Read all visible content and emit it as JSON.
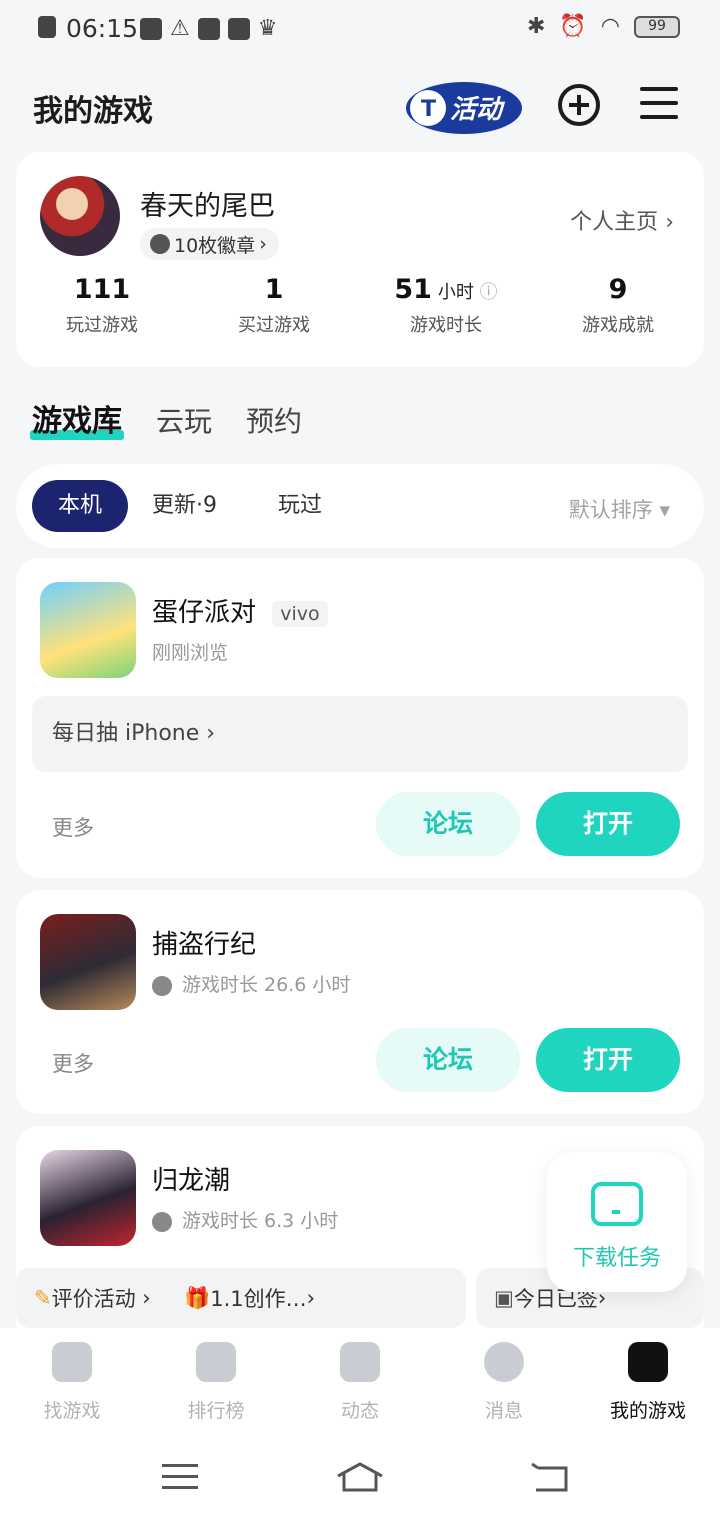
{
  "status_bar": {
    "time": "06:15",
    "battery": "99"
  },
  "header": {
    "title": "我的游戏",
    "activity_logo_text": "活动"
  },
  "profile": {
    "username": "春天的尾巴",
    "badges": "10枚徽章",
    "home_link": "个人主页",
    "stats": [
      {
        "value": "111",
        "unit": "",
        "label": "玩过游戏"
      },
      {
        "value": "1",
        "unit": "",
        "label": "买过游戏"
      },
      {
        "value": "51",
        "unit": "小时",
        "label": "游戏时长"
      },
      {
        "value": "9",
        "unit": "",
        "label": "游戏成就"
      }
    ]
  },
  "tabs": [
    {
      "label": "游戏库",
      "active": true
    },
    {
      "label": "云玩",
      "active": false
    },
    {
      "label": "预约",
      "active": false
    }
  ],
  "filters": {
    "chips": [
      {
        "label": "本机",
        "active": true
      },
      {
        "label": "更新·9",
        "active": false
      },
      {
        "label": "玩过",
        "active": false
      }
    ],
    "sort": "默认排序"
  },
  "games": [
    {
      "name": "蛋仔派对",
      "tag": "vivo",
      "sub": "刚刚浏览",
      "promo": "每日抽 iPhone",
      "more": "更多",
      "forum": "论坛",
      "open": "打开"
    },
    {
      "name": "捕盗行纪",
      "sub": "游戏时长 26.6 小时",
      "more": "更多",
      "forum": "论坛",
      "open": "打开"
    },
    {
      "name": "归龙潮",
      "sub": "游戏时长 6.3 小时"
    }
  ],
  "bottom_strip": [
    "评价活动",
    "1.1创作…",
    "今日已签"
  ],
  "download_float": {
    "label": "下载任务"
  },
  "nav": [
    {
      "label": "找游戏",
      "active": false
    },
    {
      "label": "排行榜",
      "active": false
    },
    {
      "label": "动态",
      "active": false
    },
    {
      "label": "消息",
      "active": false
    },
    {
      "label": "我的游戏",
      "active": true
    }
  ],
  "colors": {
    "accent": "#1fd5c0",
    "chip_active": "#1c2470"
  }
}
